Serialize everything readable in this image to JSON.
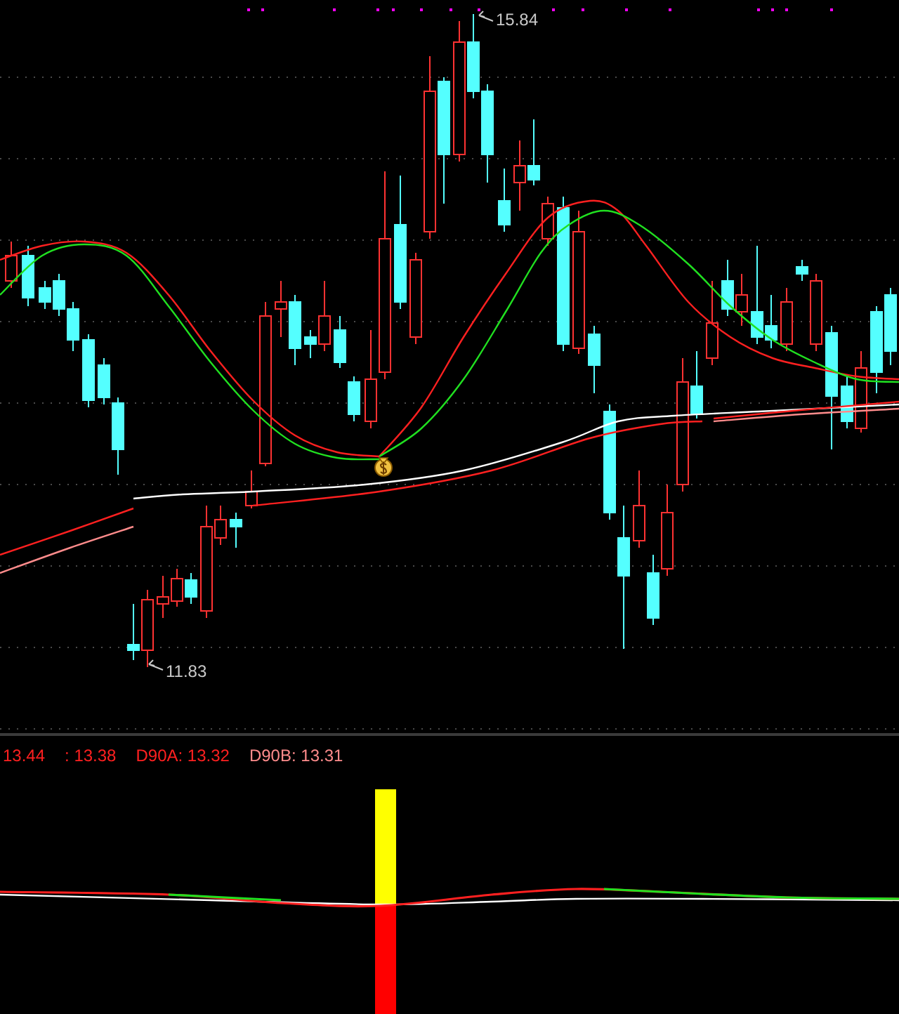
{
  "price_chart": {
    "high_label": "15.84",
    "low_label": "11.83"
  },
  "indicator_legend": [
    {
      "text": "13.44",
      "color": "#ff2020"
    },
    {
      "text": ": 13.38",
      "color": "#ff2020"
    },
    {
      "text": "D90A: 13.32",
      "color": "#ff2020"
    },
    {
      "text": "D90B: 13.31",
      "color": "#ff8c8c"
    }
  ]
}
